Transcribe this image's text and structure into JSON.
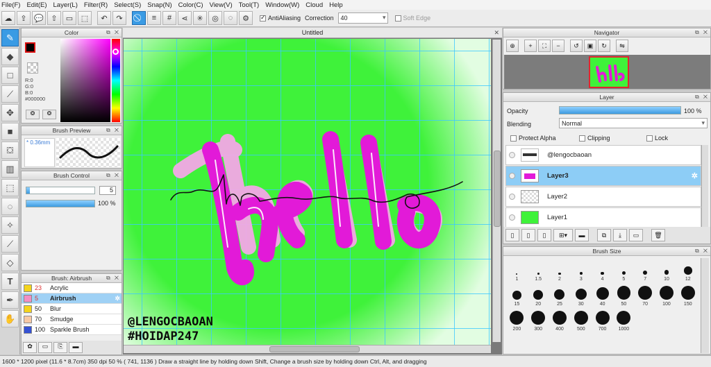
{
  "menu": [
    "File(F)",
    "Edit(E)",
    "Layer(L)",
    "Filter(R)",
    "Select(S)",
    "Snap(N)",
    "Color(C)",
    "View(V)",
    "Tool(T)",
    "Window(W)",
    "Cloud",
    "Help"
  ],
  "toolbar": {
    "antialiasing_label": "AntiAliasing",
    "correction_label": "Correction",
    "correction_value": "40",
    "softedge_label": "Soft Edge"
  },
  "color_panel": {
    "title": "Color",
    "r": "R:0",
    "g": "G:0",
    "b": "B:0",
    "hex": "#000000"
  },
  "brush_preview": {
    "title": "Brush Preview",
    "size": "0.36mm"
  },
  "brush_control": {
    "title": "Brush Control",
    "size_value": "5",
    "size_fraction": 0.05,
    "opacity_value": "100 %",
    "opacity_fraction": 1.0
  },
  "brush_list": {
    "title": "Brush: Airbrush",
    "items": [
      {
        "num": "23",
        "name": "Acrylic",
        "color": "#f4d41c"
      },
      {
        "num": "5",
        "name": "Airbrush",
        "color": "#f38ec4"
      },
      {
        "num": "50",
        "name": "Blur",
        "color": "#f4d41c"
      },
      {
        "num": "70",
        "name": "Smudge",
        "color": "#f7c9a6"
      },
      {
        "num": "100",
        "name": "Sparkle Brush",
        "color": "#3552d4"
      }
    ]
  },
  "document": {
    "tab_title": "Untitled",
    "watermark_line1": "@LENGOCBAOAN",
    "watermark_line2": "#HOIDAP247",
    "canvas_color": "#3ff23a"
  },
  "navigator": {
    "title": "Navigator"
  },
  "layer_panel": {
    "title": "Layer",
    "opacity_label": "Opacity",
    "opacity_value": "100 %",
    "opacity_fraction": 1.0,
    "blending_label": "Blending",
    "blending_value": "Normal",
    "protect_alpha": "Protect Alpha",
    "clipping": "Clipping",
    "lock": "Lock",
    "layers": [
      {
        "name": "@lengocbaoan"
      },
      {
        "name": "Layer3"
      },
      {
        "name": "Layer2"
      },
      {
        "name": "Layer1"
      }
    ]
  },
  "brush_size_panel": {
    "title": "Brush Size",
    "sizes": [
      "1",
      "1.5",
      "2",
      "3",
      "4",
      "5",
      "7",
      "10",
      "12",
      "15",
      "20",
      "25",
      "30",
      "40",
      "50",
      "70",
      "100",
      "150",
      "200",
      "300",
      "400",
      "500",
      "700",
      "1000"
    ]
  },
  "status": "1600 * 1200 pixel   (11.6 * 8.7cm)   350 dpi   50 %   ( 741, 1136 )   Draw a straight line by holding down Shift, Change a brush size by holding down Ctrl, Alt, and dragging"
}
